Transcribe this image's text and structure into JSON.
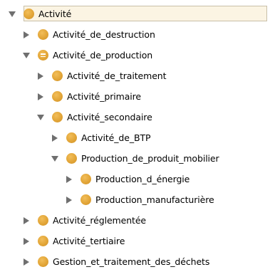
{
  "tree": {
    "rows": [
      {
        "label": "Activité",
        "level": 0,
        "toggle": "expanded",
        "icon": "class-icon",
        "selected": true
      },
      {
        "label": "Activité_de_destruction",
        "level": 1,
        "toggle": "collapsed",
        "icon": "class-icon",
        "selected": false
      },
      {
        "label": "Activité_de_production",
        "level": 1,
        "toggle": "expanded",
        "icon": "equivalent-class-icon",
        "selected": false
      },
      {
        "label": "Activité_de_traitement",
        "level": 2,
        "toggle": "collapsed",
        "icon": "class-icon",
        "selected": false
      },
      {
        "label": "Activité_primaire",
        "level": 2,
        "toggle": "collapsed",
        "icon": "class-icon",
        "selected": false
      },
      {
        "label": "Activité_secondaire",
        "level": 2,
        "toggle": "expanded",
        "icon": "class-icon",
        "selected": false
      },
      {
        "label": "Activité_de_BTP",
        "level": 3,
        "toggle": "collapsed",
        "icon": "class-icon",
        "selected": false
      },
      {
        "label": "Production_de_produit_mobilier",
        "level": 3,
        "toggle": "expanded",
        "icon": "class-icon",
        "selected": false
      },
      {
        "label": "Production_d_énergie",
        "level": 4,
        "toggle": "collapsed",
        "icon": "class-icon",
        "selected": false
      },
      {
        "label": "Production_manufacturière",
        "level": 4,
        "toggle": "collapsed",
        "icon": "class-icon",
        "selected": false
      },
      {
        "label": "Activité_réglementée",
        "level": 1,
        "toggle": "collapsed",
        "icon": "class-icon",
        "selected": false
      },
      {
        "label": "Activité_tertiaire",
        "level": 1,
        "toggle": "collapsed",
        "icon": "class-icon",
        "selected": false
      },
      {
        "label": "Gestion_et_traitement_des_déchets",
        "level": 1,
        "toggle": "collapsed",
        "icon": "class-icon",
        "selected": false
      }
    ]
  },
  "colors": {
    "node": "#e2a537",
    "toggle": "#6f6f6f",
    "selection_bg": "#fbf4e3",
    "selection_border": "#c8bfa8"
  }
}
